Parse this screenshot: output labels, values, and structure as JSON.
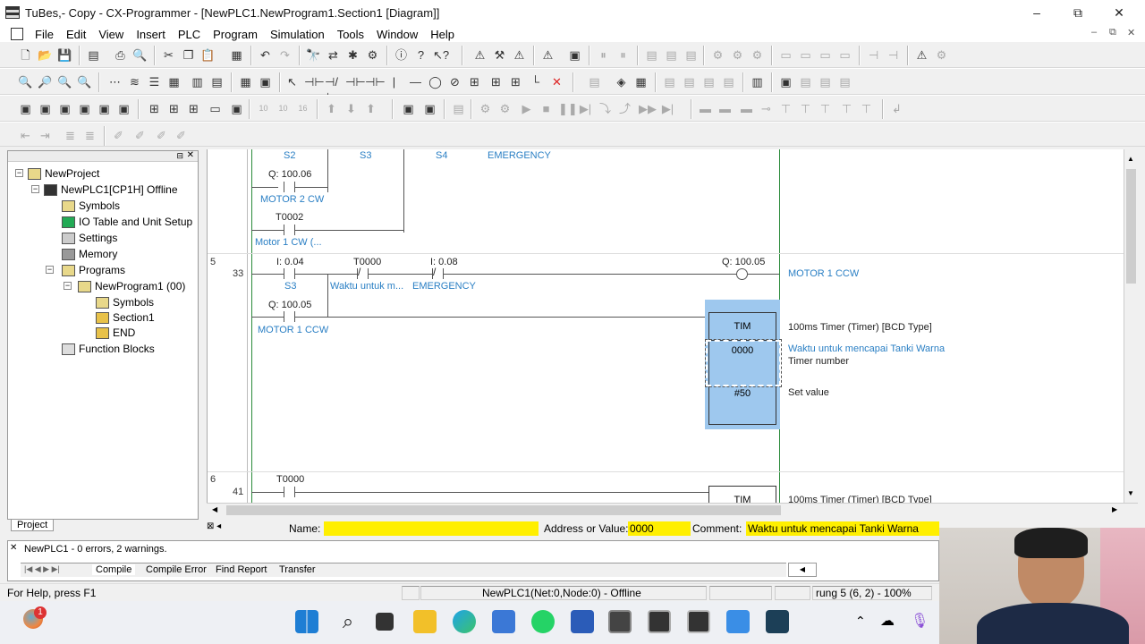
{
  "window": {
    "title": "TuBes,- Copy - CX-Programmer - [NewPLC1.NewProgram1.Section1 [Diagram]]",
    "minimize": "–",
    "maximize": "⧉",
    "close": "✕"
  },
  "menu": [
    "File",
    "Edit",
    "View",
    "Insert",
    "PLC",
    "Program",
    "Simulation",
    "Tools",
    "Window",
    "Help"
  ],
  "project_tree": {
    "items": [
      {
        "label": "NewProject",
        "icon": "project-icon"
      },
      {
        "label": "NewPLC1[CP1H] Offline",
        "icon": "plc-icon"
      },
      {
        "label": "Symbols",
        "icon": "symbols-icon"
      },
      {
        "label": "IO Table and Unit Setup",
        "icon": "io-table-icon"
      },
      {
        "label": "Settings",
        "icon": "settings-icon"
      },
      {
        "label": "Memory",
        "icon": "memory-icon"
      },
      {
        "label": "Programs",
        "icon": "programs-icon"
      },
      {
        "label": "NewProgram1 (00)",
        "icon": "program-icon"
      },
      {
        "label": "Symbols",
        "icon": "symbols-icon"
      },
      {
        "label": "Section1",
        "icon": "section-icon"
      },
      {
        "label": "END",
        "icon": "section-icon"
      },
      {
        "label": "Function Blocks",
        "icon": "function-blocks-icon"
      }
    ],
    "tab": "Project"
  },
  "diagram": {
    "rung4_top": {
      "s2": "S2",
      "s3": "S3",
      "s4": "S4",
      "emergency": "EMERGENCY",
      "q10006": "Q: 100.06",
      "motor2cw": "MOTOR 2 CW",
      "t0002": "T0002",
      "motor1cw": "Motor 1 CW (..."
    },
    "rung5": {
      "rung": "5",
      "step": "33",
      "i004": "I: 0.04",
      "s3": "S3",
      "t0000": "T0000",
      "waktu_short": "Waktu untuk m...",
      "i008": "I: 0.08",
      "emergency": "EMERGENCY",
      "q10005_coil": "Q: 100.05",
      "coil_comment": "MOTOR 1 CCW",
      "q10005_contact": "Q: 100.05",
      "contact_comment": "MOTOR 1 CCW",
      "tim": "TIM",
      "timer_num": "0000",
      "set_val": "#50",
      "tim_desc": "100ms Timer (Timer) [BCD Type]",
      "timer_comment": "Waktu untuk mencapai Tanki Warna",
      "timer_number_label": "Timer number",
      "set_value_label": "Set value"
    },
    "rung6": {
      "rung": "6",
      "step": "41",
      "t0000": "T0000",
      "tim": "TIM",
      "tim_desc": "100ms Timer (Timer) [BCD Type]"
    }
  },
  "infobar": {
    "name_label": "Name:",
    "name_value": "",
    "address_label": "Address or Value:",
    "address_value": "0000",
    "comment_label": "Comment:",
    "comment_value": "Waktu untuk mencapai Tanki Warna"
  },
  "output": {
    "message": "NewPLC1 - 0 errors, 2 warnings.",
    "tabs": [
      "Compile",
      "Compile Error",
      "Find Report",
      "Transfer"
    ]
  },
  "status": {
    "help": "For Help, press F1",
    "plc": "NewPLC1(Net:0,Node:0) - Offline",
    "position": "rung 5 (6, 2)  - 100%"
  },
  "taskbar": {
    "badge": "1"
  }
}
